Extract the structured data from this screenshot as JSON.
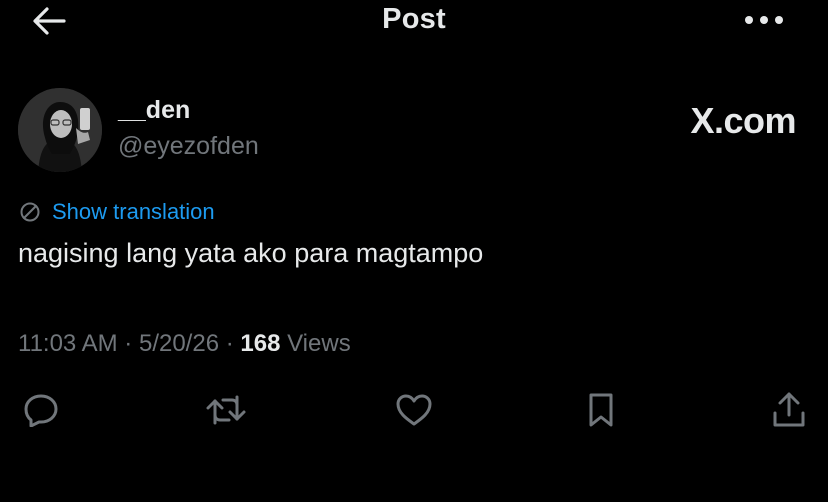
{
  "header": {
    "title": "Post",
    "back_icon": "arrow-left-icon",
    "more_icon": "more-horizontal-icon"
  },
  "author": {
    "display_name": "__den",
    "handle": "@eyezofden"
  },
  "watermark": "X.com",
  "post": {
    "translation_label": "Show translation",
    "text": "nagising lang yata ako para magtampo",
    "time": "11:03 AM",
    "date": "5/20/26",
    "views_count": "168",
    "views_label": "Views",
    "separator": "·"
  },
  "actions": [
    {
      "icon": "reply-icon"
    },
    {
      "icon": "repost-icon"
    },
    {
      "icon": "like-icon"
    },
    {
      "icon": "bookmark-icon"
    },
    {
      "icon": "share-icon"
    }
  ],
  "colors": {
    "background": "#000000",
    "text_primary": "#e7e9ea",
    "text_secondary": "#71767b",
    "link_blue": "#1d9bf0"
  }
}
